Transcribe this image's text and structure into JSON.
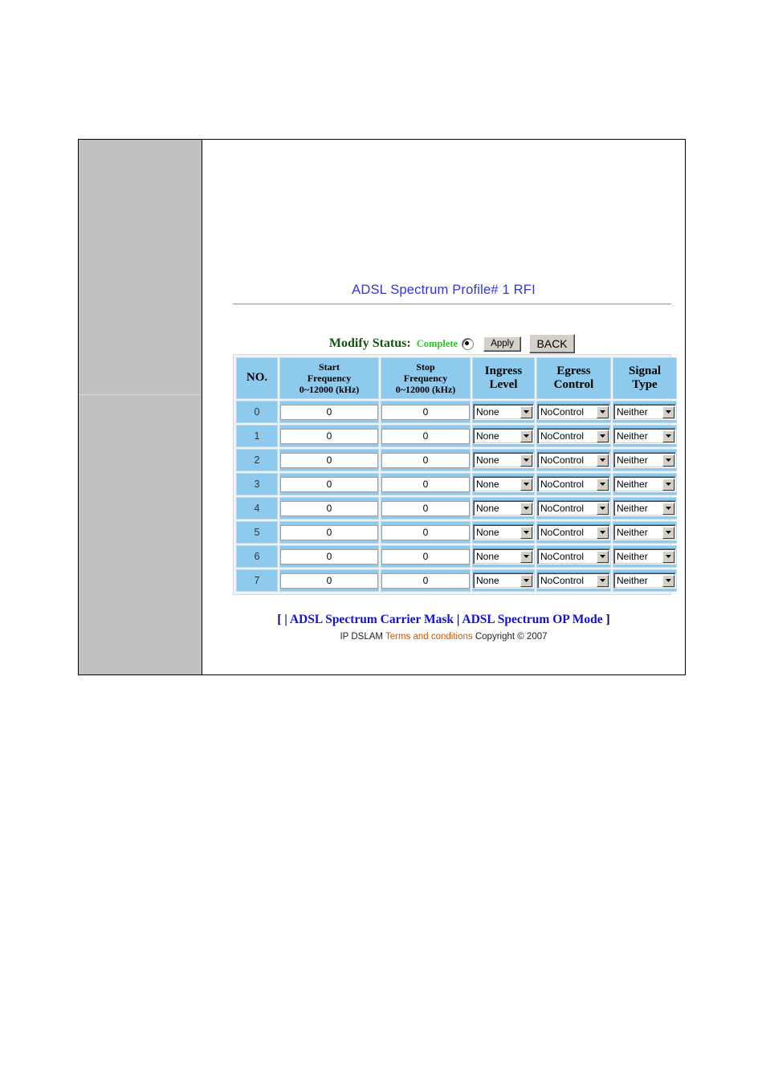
{
  "page": {
    "title": "ADSL Spectrum Profile# 1 RFI"
  },
  "status_bar": {
    "label": "Modify Status:",
    "value": "Complete",
    "radio_selected": true,
    "apply_label": "Apply",
    "back_label": "BACK"
  },
  "table": {
    "headers": {
      "no": "NO.",
      "start_line1": "Start",
      "start_line2": "Frequency",
      "start_line3": "0~12000 (kHz)",
      "stop_line1": "Stop",
      "stop_line2": "Frequency",
      "stop_line3": "0~12000 (kHz)",
      "ingress_line1": "Ingress",
      "ingress_line2": "Level",
      "egress_line1": "Egress",
      "egress_line2": "Control",
      "signal_line1": "Signal",
      "signal_line2": "Type"
    },
    "rows": [
      {
        "no": "0",
        "start_frequency": "0",
        "stop_frequency": "0",
        "ingress_level": "None",
        "egress_control": "NoControl",
        "signal_type": "Neither"
      },
      {
        "no": "1",
        "start_frequency": "0",
        "stop_frequency": "0",
        "ingress_level": "None",
        "egress_control": "NoControl",
        "signal_type": "Neither"
      },
      {
        "no": "2",
        "start_frequency": "0",
        "stop_frequency": "0",
        "ingress_level": "None",
        "egress_control": "NoControl",
        "signal_type": "Neither"
      },
      {
        "no": "3",
        "start_frequency": "0",
        "stop_frequency": "0",
        "ingress_level": "None",
        "egress_control": "NoControl",
        "signal_type": "Neither"
      },
      {
        "no": "4",
        "start_frequency": "0",
        "stop_frequency": "0",
        "ingress_level": "None",
        "egress_control": "NoControl",
        "signal_type": "Neither"
      },
      {
        "no": "5",
        "start_frequency": "0",
        "stop_frequency": "0",
        "ingress_level": "None",
        "egress_control": "NoControl",
        "signal_type": "Neither"
      },
      {
        "no": "6",
        "start_frequency": "0",
        "stop_frequency": "0",
        "ingress_level": "None",
        "egress_control": "NoControl",
        "signal_type": "Neither"
      },
      {
        "no": "7",
        "start_frequency": "0",
        "stop_frequency": "0",
        "ingress_level": "None",
        "egress_control": "NoControl",
        "signal_type": "Neither"
      }
    ]
  },
  "footer": {
    "bracket_open": "[",
    "pipe_first": "|",
    "link_carrier_mask": "ADSL Spectrum Carrier Mask",
    "pipe_second": "|",
    "link_op_mode": "ADSL Spectrum OP Mode",
    "bracket_close": "]",
    "copy_prefix": "IP DSLAM",
    "copy_terms": "Terms and conditions",
    "copy_suffix": "Copyright © 2007"
  },
  "colors": {
    "title_blue": "#3333ee",
    "cell_blue": "#8ecaee",
    "nav_gray": "#c0c0c0",
    "status_green": "#22cc22",
    "label_green": "#115511",
    "link_blue": "#1111dd",
    "terms_orange": "#cc5500"
  }
}
